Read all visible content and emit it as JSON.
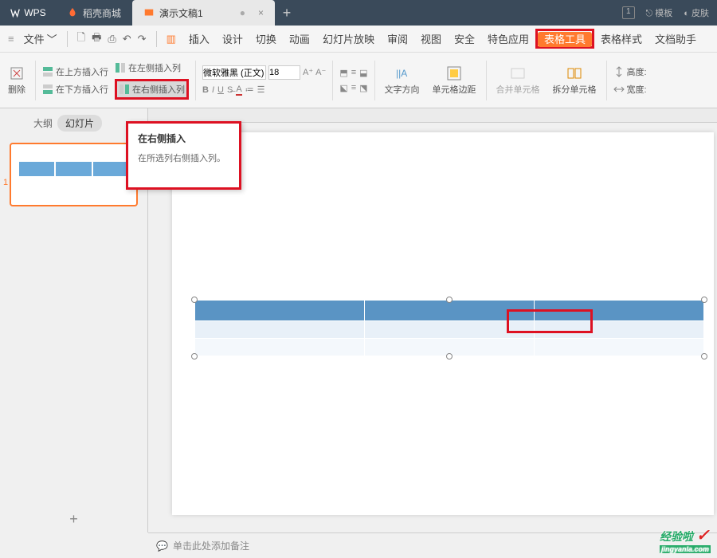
{
  "titlebar": {
    "app": "WPS",
    "store_tab": "稻壳商城",
    "doc_tab": "演示文稿1",
    "dot": "●",
    "num": "1",
    "template": "模板",
    "skin": "皮肤"
  },
  "menubar": {
    "file": "文件",
    "items": [
      "插入",
      "设计",
      "切换",
      "动画",
      "幻灯片放映",
      "审阅",
      "视图",
      "安全",
      "特色应用",
      "表格工具",
      "表格样式",
      "文档助手"
    ]
  },
  "ribbon": {
    "delete": "删除",
    "insert_row_above": "在上方插入行",
    "insert_row_below": "在下方插入行",
    "insert_col_left": "在左侧插入列",
    "insert_col_right": "在右侧插入列",
    "font_name": "微软雅黑 (正文)",
    "font_size": "18",
    "text_direction": "文字方向",
    "cell_margin": "单元格边距",
    "merge_cells": "合并单元格",
    "split_cells": "拆分单元格",
    "height": "高度:",
    "width": "宽度:"
  },
  "tooltip": {
    "title": "在右侧插入",
    "desc": "在所选列右侧插入列。"
  },
  "leftpanel": {
    "outline": "大纲",
    "slides": "幻灯片",
    "num": "1",
    "add": "+"
  },
  "canvas": {
    "hint_text": "",
    "notes": "单击此处添加备注"
  },
  "watermark": {
    "main": "经验啦",
    "sub": "jingyanla.com",
    "check": "✓"
  }
}
